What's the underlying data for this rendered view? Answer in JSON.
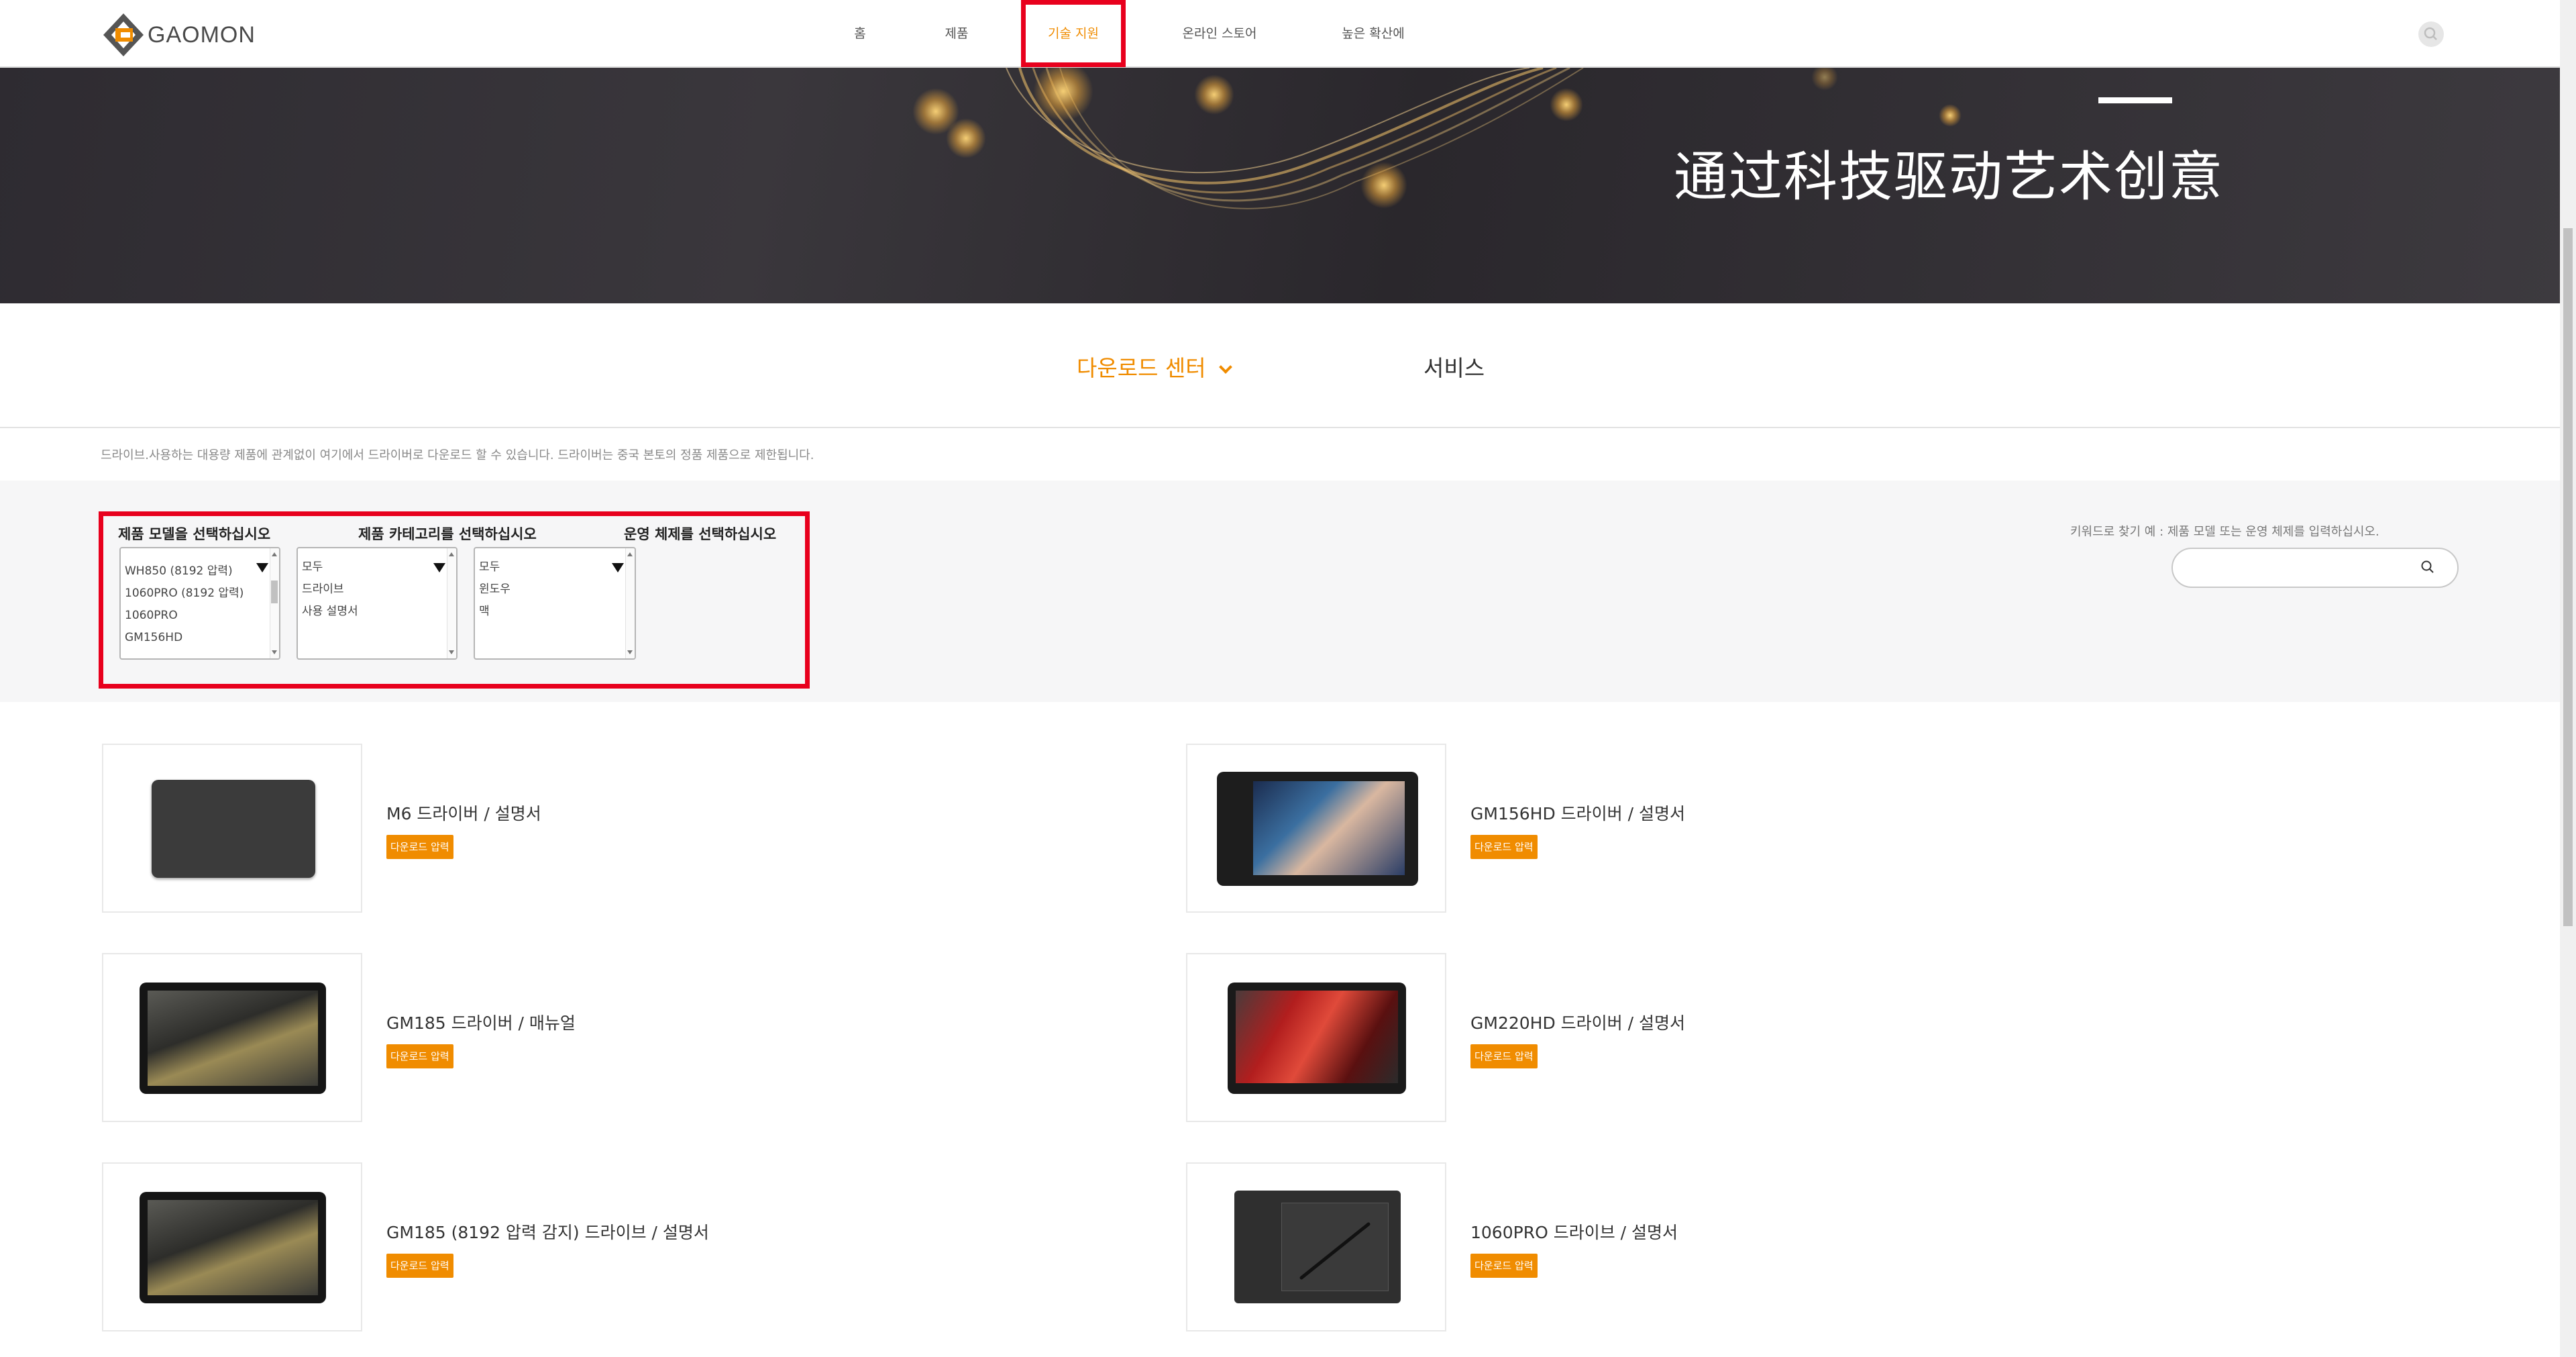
{
  "header": {
    "logo_text": "GAOMON",
    "nav": [
      {
        "label": "홈"
      },
      {
        "label": "제품"
      },
      {
        "label": "기술 지원"
      },
      {
        "label": "온라인 스토어"
      },
      {
        "label": "높은 확산에"
      }
    ],
    "active_nav": "기술 지원",
    "accent_color": "#f08c00",
    "highlight_color": "#e8001d"
  },
  "banner": {
    "title": "通过科技驱动艺术创意"
  },
  "tabs": {
    "download_center": "다운로드 센터",
    "service": "서비스"
  },
  "notice": "드라이브.사용하는 대용량 제품에 관계없이 여기에서 드라이버로 다운로드 할 수 있습니다. 드라이버는 중국 본토의 정품 제품으로 제한됩니다.",
  "filters": {
    "model_label": "제품 모델을 선택하십시오",
    "category_label": "제품 카테고리를 선택하십시오",
    "os_label": "운영 체제를 선택하십시오",
    "model_options": [
      "WH850 (8192 압력)",
      "1060PRO (8192 압력)",
      "1060PRO",
      "GM156HD"
    ],
    "category_options": [
      "모두",
      "드라이브",
      "사용 설명서"
    ],
    "os_options": [
      "모두",
      "윈도우",
      "맥"
    ]
  },
  "search": {
    "label": "키워드로 찾기 예 : 제품 모델 또는 운영 체제를 입력하십시오.",
    "value": ""
  },
  "products": [
    {
      "title": "M6 드라이버 / 설명서",
      "button": "다운로드 압력"
    },
    {
      "title": "GM156HD 드라이버 / 설명서",
      "button": "다운로드 압력"
    },
    {
      "title": "GM185 드라이버 / 매뉴얼",
      "button": "다운로드 압력"
    },
    {
      "title": "GM220HD 드라이버 / 설명서",
      "button": "다운로드 압력"
    },
    {
      "title": "GM185 (8192 압력 감지) 드라이브 / 설명서",
      "button": "다운로드 압력"
    },
    {
      "title": "1060PRO 드라이브 / 설명서",
      "button": "다운로드 압력"
    }
  ]
}
